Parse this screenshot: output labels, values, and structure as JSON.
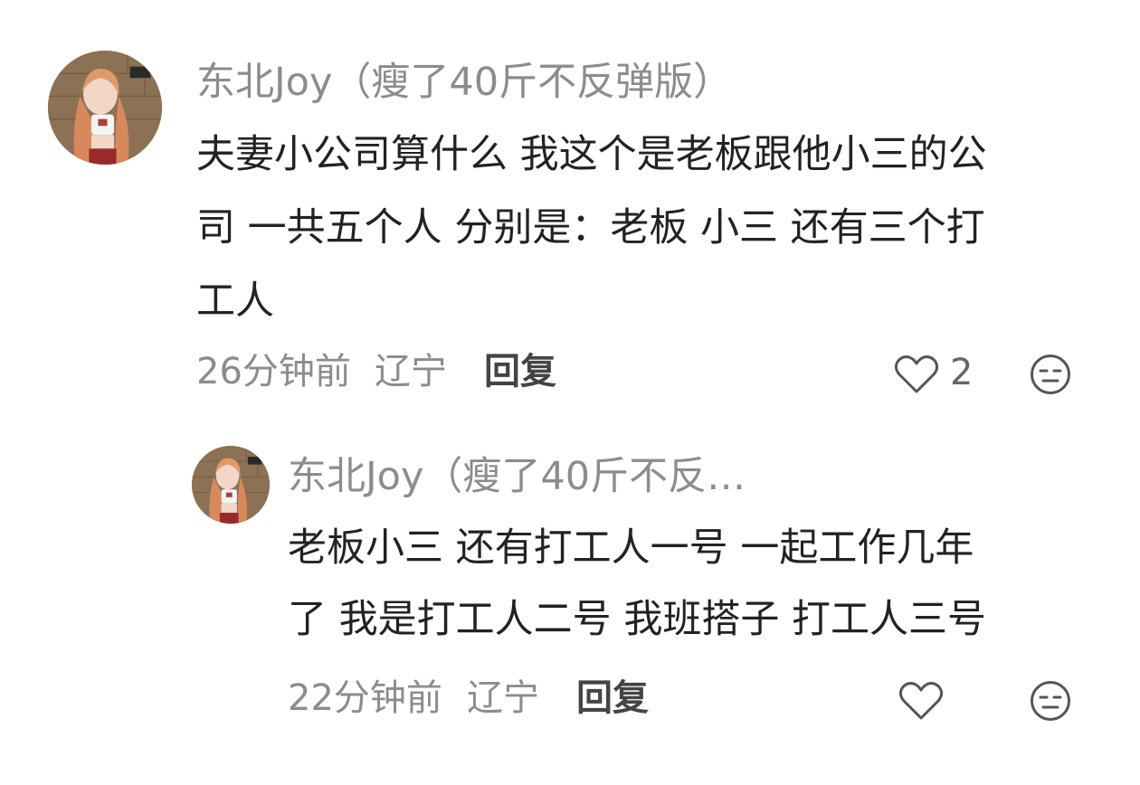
{
  "comments": [
    {
      "username": "东北Joy（瘦了40斤不反弹版）",
      "avatar_icon": "user-avatar-photo",
      "text_lines": [
        "夫妻小公司算什么 我这个是老板跟他小三的公",
        "司 一共五个人 分别是：老板 小三 还有三个打",
        "工人"
      ],
      "time": "26分钟前",
      "location": "辽宁",
      "reply_label": "回复",
      "like_icon": "heart-outline-icon",
      "like_count": "2",
      "dislike_icon": "neutral-face-icon"
    },
    {
      "username": "东北Joy（瘦了40斤不反…",
      "avatar_icon": "user-avatar-photo",
      "text_lines": [
        "老板小三 还有打工人一号 一起工作几年",
        "了 我是打工人二号 我班搭子 打工人三号"
      ],
      "time": "22分钟前",
      "location": "辽宁",
      "reply_label": "回复",
      "like_icon": "heart-outline-icon",
      "dislike_icon": "neutral-face-icon"
    }
  ],
  "colors": {
    "background": "#ffffff",
    "meta_text": "#8c8c8c",
    "body_text": "#222222",
    "icon_stroke": "#555555"
  }
}
